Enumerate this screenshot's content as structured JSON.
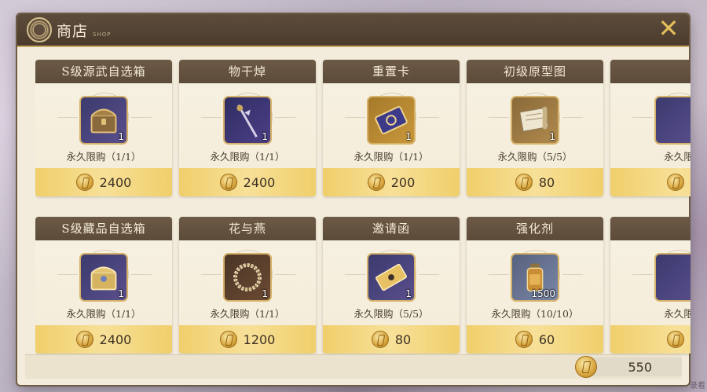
{
  "shop": {
    "title": "商店",
    "subtitle": "SHOP",
    "close_icon": "close-x-icon"
  },
  "items": [
    {
      "name": "S级源武自选箱",
      "qty": "1",
      "limit": "永久限购（1/1）",
      "price": "2400",
      "icon": "chest-icon"
    },
    {
      "name": "物干焯",
      "qty": "1",
      "limit": "永久限购（1/1）",
      "price": "2400",
      "icon": "staff-weapon-icon"
    },
    {
      "name": "重置卡",
      "qty": "1",
      "limit": "永久限购（1/1）",
      "price": "200",
      "icon": "card-icon"
    },
    {
      "name": "初级原型图",
      "qty": "1",
      "limit": "永久限购（5/5）",
      "price": "80",
      "icon": "scroll-icon"
    },
    {
      "name": "",
      "qty": "",
      "limit": "永久限",
      "price": "",
      "icon": "partial-icon"
    },
    {
      "name": "S级藏品自选箱",
      "qty": "1",
      "limit": "永久限购（1/1）",
      "price": "2400",
      "icon": "ornate-chest-icon"
    },
    {
      "name": "花与燕",
      "qty": "1",
      "limit": "永久限购（1/1）",
      "price": "1200",
      "icon": "wreath-icon"
    },
    {
      "name": "邀请函",
      "qty": "1",
      "limit": "永久限购（5/5）",
      "price": "80",
      "icon": "ticket-icon"
    },
    {
      "name": "强化剂",
      "qty": "1500",
      "limit": "永久限购（10/10）",
      "price": "60",
      "icon": "bottle-icon"
    },
    {
      "name": "",
      "qty": "",
      "limit": "永久限",
      "price": "",
      "icon": "partial-icon"
    }
  ],
  "balance": "550",
  "watermark": "录看"
}
